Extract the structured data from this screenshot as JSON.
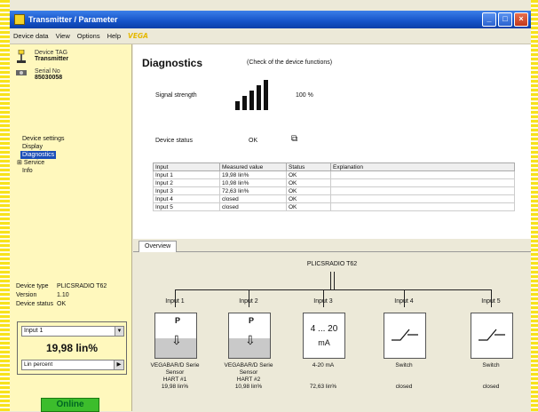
{
  "window": {
    "title": "Transmitter / Parameter",
    "logo": "VEGA"
  },
  "menu": [
    "Device data",
    "View",
    "Options",
    "Help"
  ],
  "sidebar": {
    "device_tag_label": "Device TAG",
    "device_tag_value": "Transmitter",
    "serial_label": "Serial No",
    "serial_value": "85030058",
    "tree": [
      "Device settings",
      "Display",
      "Diagnostics",
      "Service",
      "Info"
    ],
    "device_type_label": "Device type",
    "device_type_value": "PLICSRADIO T62",
    "version_label": "Version",
    "version_value": "1.10",
    "status_label": "Device status",
    "status_value": "OK",
    "meter_select": "Input 1",
    "meter_value": "19,98 lin%",
    "meter_bar_label": "Lin percent"
  },
  "diagnostics": {
    "title": "Diagnostics",
    "subtitle": "(Check of the device functions)",
    "signal_label": "Signal strength",
    "signal_value": "100 %",
    "status_label": "Device status",
    "status_value": "OK",
    "columns": [
      "Input",
      "Measured value",
      "Status",
      "Explanation"
    ],
    "rows": [
      [
        "Input 1",
        "19,98 lin%",
        "OK",
        ""
      ],
      [
        "Input 2",
        "10,98 lin%",
        "OK",
        ""
      ],
      [
        "Input 3",
        "72,63 lin%",
        "OK",
        ""
      ],
      [
        "Input 4",
        "closed",
        "OK",
        ""
      ],
      [
        "Input 5",
        "closed",
        "OK",
        ""
      ]
    ]
  },
  "overview": {
    "tab": "Overview",
    "device": "PLICSRADIO T62",
    "inputs": [
      {
        "label": "Input 1",
        "kind": "sensor",
        "cap1": "VEGABAR/D Serie",
        "cap2": "Sensor",
        "cap3": "HART #1",
        "value": "19,98 lin%"
      },
      {
        "label": "Input 2",
        "kind": "sensor",
        "cap1": "VEGABAR/D Serie",
        "cap2": "Sensor",
        "cap3": "HART #2",
        "value": "10,98 lin%"
      },
      {
        "label": "Input 3",
        "kind": "ma",
        "ma1": "4 ... 20",
        "ma2": "mA",
        "cap1": "4-20 mA",
        "value": "72,63 lin%"
      },
      {
        "label": "Input 4",
        "kind": "switch",
        "cap1": "Switch",
        "value": "closed"
      },
      {
        "label": "Input 5",
        "kind": "switch",
        "cap1": "Switch",
        "value": "closed"
      }
    ]
  },
  "status": {
    "online": "Online"
  }
}
